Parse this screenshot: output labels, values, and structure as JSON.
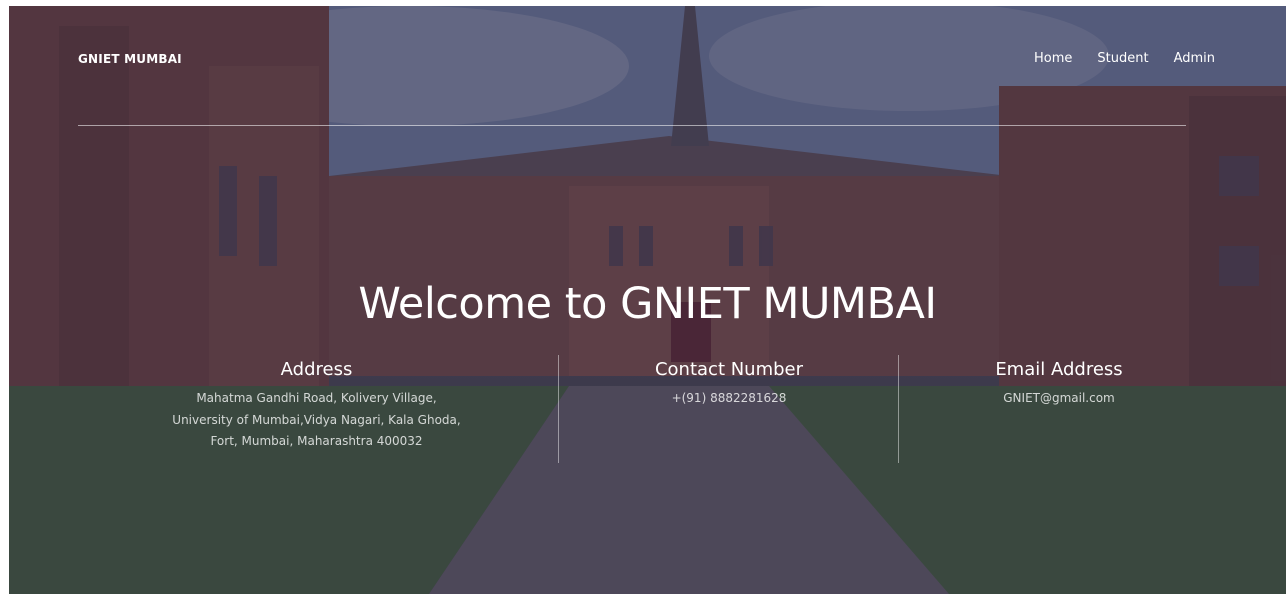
{
  "nav": {
    "brand": "GNIET MUMBAI",
    "links": [
      "Home",
      "Student",
      "Admin"
    ]
  },
  "hero": {
    "title": "Welcome to GNIET MUMBAI"
  },
  "info": {
    "address": {
      "heading": "Address",
      "lines": [
        "Mahatma Gandhi Road, Kolivery Village,",
        "University of Mumbai,Vidya Nagari, Kala Ghoda,",
        "Fort, Mumbai, Maharashtra 400032"
      ]
    },
    "contact": {
      "heading": "Contact Number",
      "value": "+(91) 8882281628"
    },
    "email": {
      "heading": "Email Address",
      "value": "GNIET@gmail.com"
    }
  },
  "colors": {
    "overlay": "#2a2640",
    "text": "#ffffff"
  }
}
